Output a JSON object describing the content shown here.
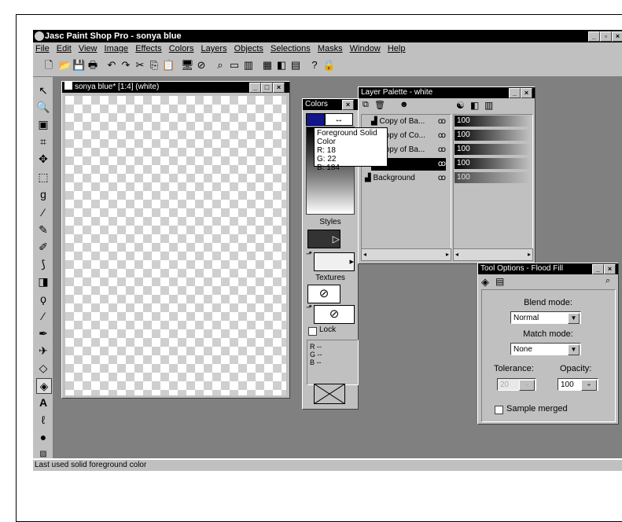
{
  "app": {
    "title": "Jasc Paint Shop Pro - sonya blue"
  },
  "menu": [
    "File",
    "Edit",
    "View",
    "Image",
    "Effects",
    "Colors",
    "Layers",
    "Objects",
    "Selections",
    "Masks",
    "Window",
    "Help"
  ],
  "document": {
    "title": "sonya blue* [1:4] (white)"
  },
  "colors_palette": {
    "title": "Colors",
    "swap_glyph": "↔",
    "styles_label": "Styles",
    "textures_label": "Textures",
    "lock_label": "Lock",
    "rgb": [
      {
        "ch": "R",
        "v": "--"
      },
      {
        "ch": "G",
        "v": "--"
      },
      {
        "ch": "B",
        "v": "--"
      }
    ],
    "foreground_color": "#12168b"
  },
  "tooltip": {
    "lines": [
      "Foreground Solid Color",
      "R: 18",
      "G: 22",
      "B: 184"
    ]
  },
  "layer_palette": {
    "title": "Layer Palette - white",
    "layers": [
      {
        "name": "Copy of Ba...",
        "opacity": "100"
      },
      {
        "name": "Copy of Co...",
        "opacity": "100"
      },
      {
        "name": "Copy of Ba...",
        "opacity": "100"
      },
      {
        "name": "",
        "opacity": "100"
      },
      {
        "name": "Background",
        "opacity": "100"
      }
    ]
  },
  "tool_options": {
    "title": "Tool Options - Flood Fill",
    "blend_mode_label": "Blend mode:",
    "blend_mode": "Normal",
    "match_mode_label": "Match mode:",
    "match_mode": "None",
    "tolerance_label": "Tolerance:",
    "tolerance": "20",
    "opacity_label": "Opacity:",
    "opacity": "100",
    "sample_merged_label": "Sample merged"
  },
  "status": {
    "text": "Last used solid foreground color"
  }
}
